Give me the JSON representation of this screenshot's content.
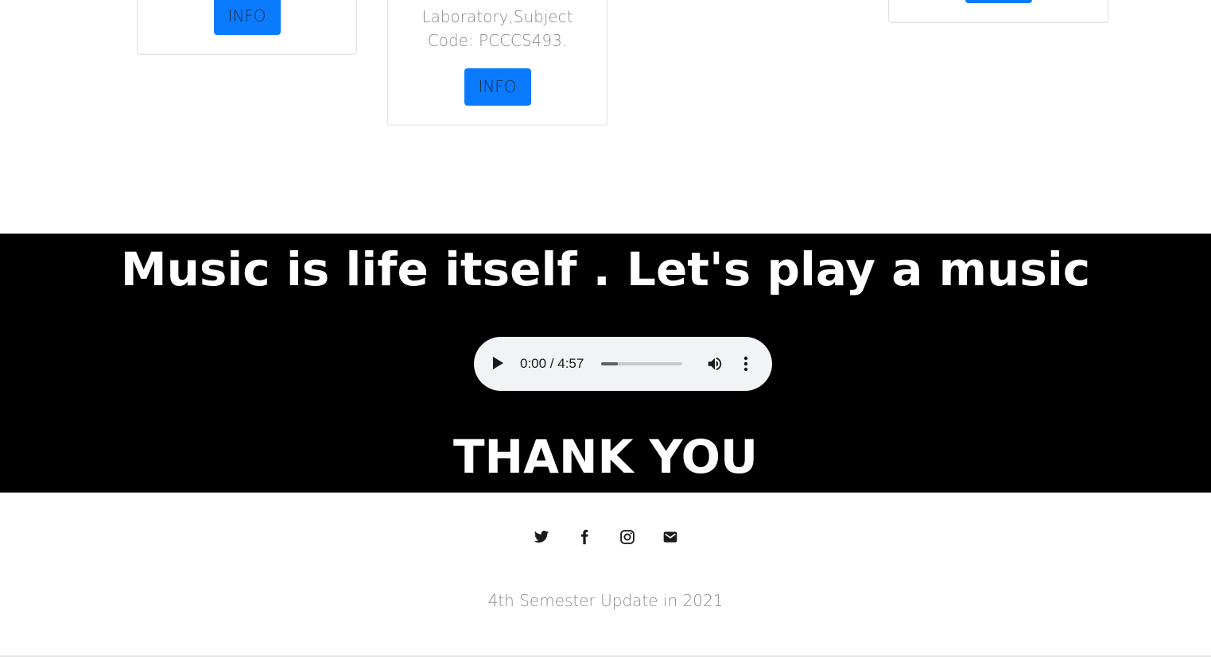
{
  "cards": [
    {
      "button_label": "INFO"
    },
    {
      "description_lines": [
        "Laboratory,Subject",
        "Code: PCCCS493."
      ],
      "button_label": "INFO"
    },
    {
      "button_label": ""
    }
  ],
  "music": {
    "title": "Music is life itself . Let's play a music",
    "player": {
      "time": "0:00 / 4:57",
      "buffered_fraction": 0.21,
      "play_icon": "play-icon",
      "volume_icon": "volume-icon",
      "menu_icon": "more-vertical-icon"
    },
    "closing": "THANK YOU"
  },
  "footer": {
    "social": [
      {
        "name": "twitter-icon"
      },
      {
        "name": "facebook-icon"
      },
      {
        "name": "instagram-icon"
      },
      {
        "name": "email-icon"
      }
    ],
    "text": "4th Semester Update in 2021"
  },
  "colors": {
    "button_blue": "#0a7bff",
    "band_black": "#000000",
    "muted_text": "#8a8a8a"
  }
}
